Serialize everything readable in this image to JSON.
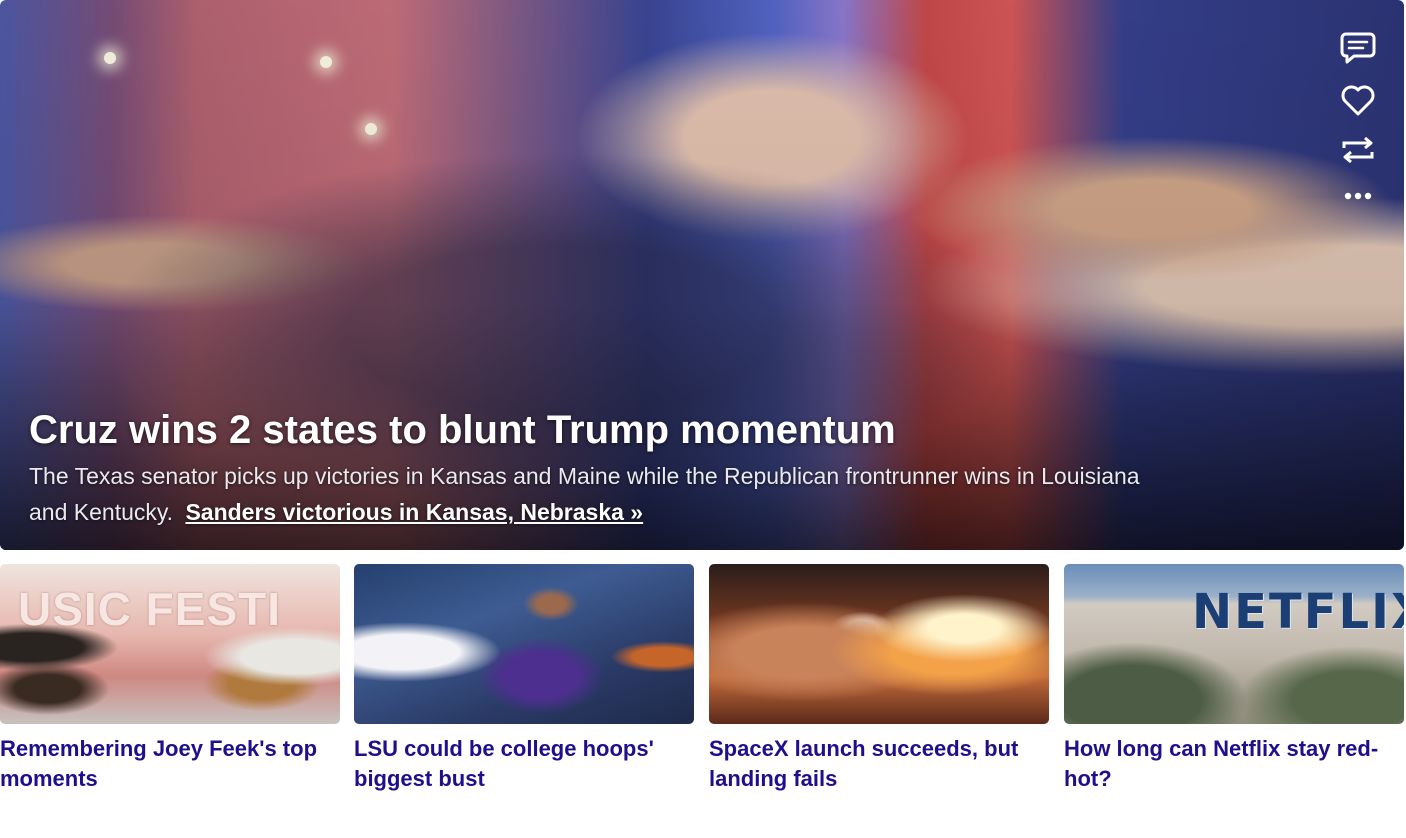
{
  "hero": {
    "headline": "Cruz wins 2 states to blunt Trump momentum",
    "summary": "The Texas senator picks up victories in Kansas and Maine while the Republican frontrunner wins in Louisiana and Kentucky.",
    "link_label": "Sanders victorious in Kansas, Nebraska »"
  },
  "actions": [
    {
      "name": "comment",
      "icon": "speech-bubble-icon"
    },
    {
      "name": "favorite",
      "icon": "heart-icon"
    },
    {
      "name": "share",
      "icon": "repost-icon"
    },
    {
      "name": "more",
      "icon": "ellipsis-icon"
    }
  ],
  "stories": [
    {
      "title": "Remembering Joey Feek's top moments",
      "image_text": "USIC FESTI"
    },
    {
      "title": "LSU could be college hoops' biggest bust"
    },
    {
      "title": "SpaceX launch succeeds, but landing fails"
    },
    {
      "title": "How long can Netflix stay red-hot?",
      "image_text": "NETFLIX"
    }
  ],
  "colors": {
    "headline_link": "#1f0f8c",
    "hero_text": "#ffffff"
  }
}
